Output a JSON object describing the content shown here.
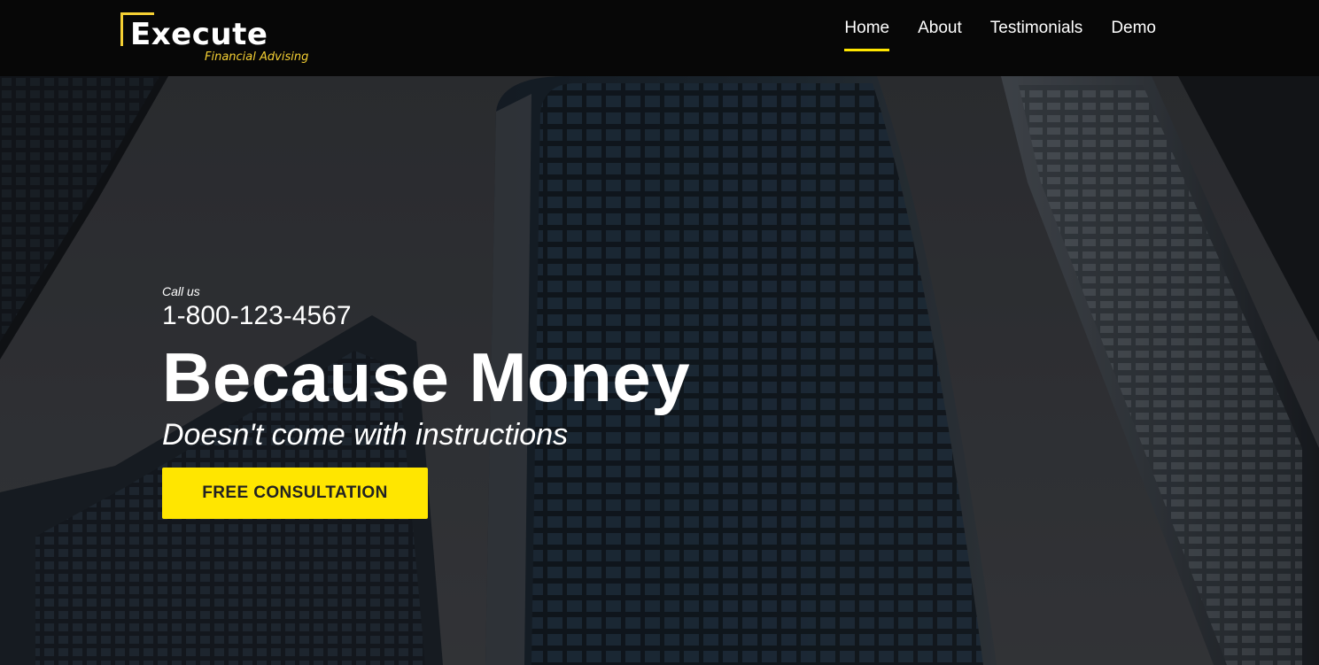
{
  "brand": {
    "name": "Execute",
    "tagline": "Financial Advising"
  },
  "nav": {
    "items": [
      {
        "label": "Home",
        "active": true
      },
      {
        "label": "About",
        "active": false
      },
      {
        "label": "Testimonials",
        "active": false
      },
      {
        "label": "Demo",
        "active": false
      }
    ]
  },
  "hero": {
    "call_label": "Call us",
    "phone": "1-800-123-4567",
    "headline": "Because Money",
    "subheadline": "Doesn't come with instructions",
    "cta_label": "FREE CONSULTATION"
  },
  "colors": {
    "accent": "#ffe600",
    "logo_accent": "#f5d033",
    "header_bg": "#070707",
    "text": "#ffffff"
  }
}
